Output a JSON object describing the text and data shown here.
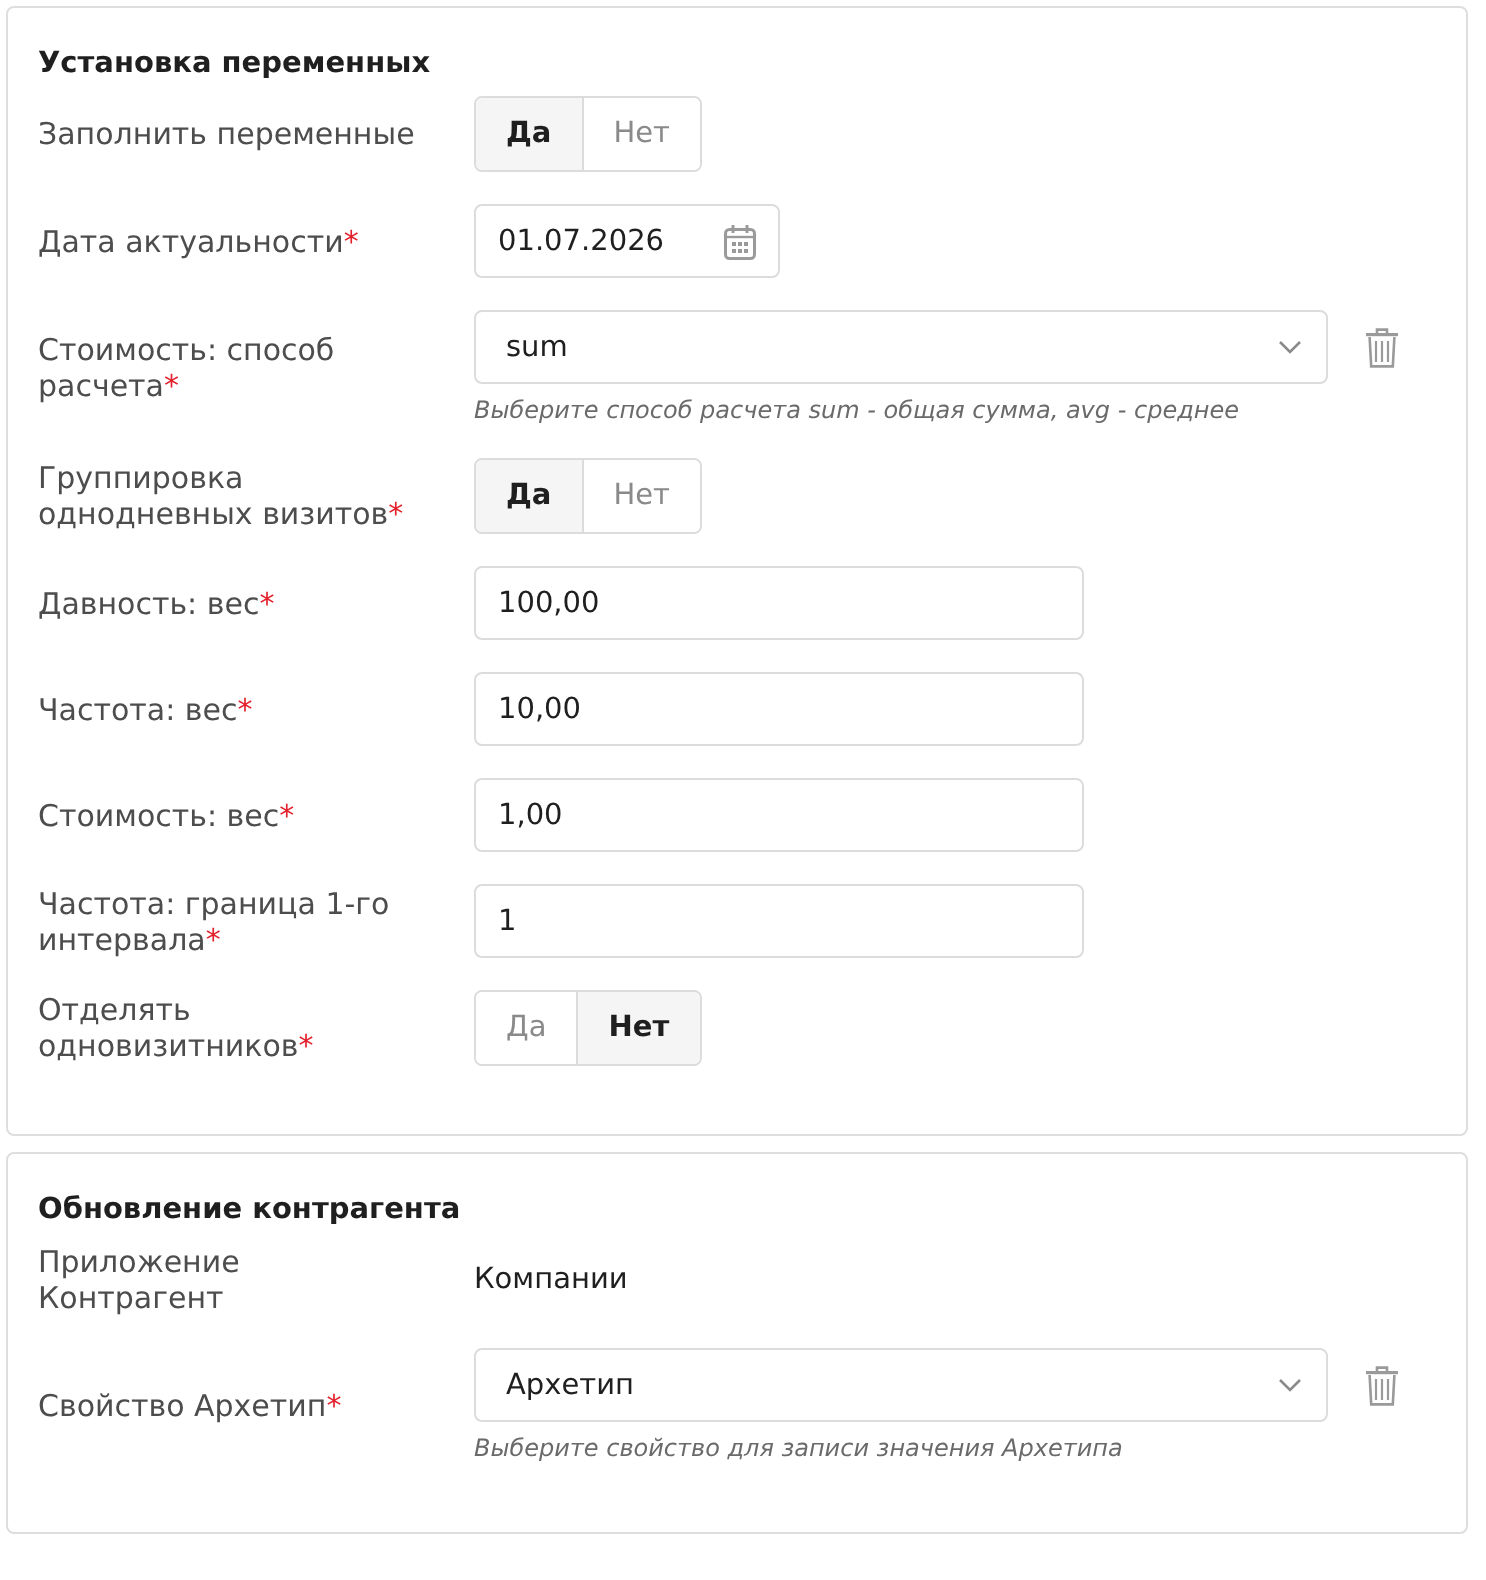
{
  "sections": [
    {
      "title": "Установка переменных",
      "fields": [
        {
          "kind": "toggle",
          "label": "Заполнить переменные",
          "options": [
            {
              "label": "Да",
              "selected": true
            },
            {
              "label": "Нет",
              "selected": false
            }
          ]
        },
        {
          "kind": "date",
          "label": "Дата актуальности",
          "required_mark": "*",
          "value": "01.07.2026"
        },
        {
          "kind": "select",
          "label": "Стоимость: способ расчета",
          "required_mark": "*",
          "value": "sum",
          "hint": "Выберите способ расчета sum - общая сумма, avg - среднее",
          "removable": true
        },
        {
          "kind": "toggle",
          "label": "Группировка однодневных визитов",
          "required_mark": "*",
          "options": [
            {
              "label": "Да",
              "selected": true
            },
            {
              "label": "Нет",
              "selected": false
            }
          ]
        },
        {
          "kind": "number",
          "label": "Давность: вес",
          "required_mark": "*",
          "value": "100,00"
        },
        {
          "kind": "number",
          "label": "Частота: вес",
          "required_mark": "*",
          "value": "10,00"
        },
        {
          "kind": "number",
          "label": "Стоимость: вес",
          "required_mark": "*",
          "value": "1,00"
        },
        {
          "kind": "number",
          "label": "Частота: граница 1-го интервала",
          "required_mark": "*",
          "value": "1"
        },
        {
          "kind": "toggle",
          "label": "Отделять одновизитников",
          "required_mark": "*",
          "options": [
            {
              "label": "Да",
              "selected": false
            },
            {
              "label": "Нет",
              "selected": true
            }
          ]
        }
      ]
    },
    {
      "title": "Обновление контрагента",
      "fields": [
        {
          "kind": "static",
          "label": "Приложение Контрагент",
          "value": "Компании"
        },
        {
          "kind": "select",
          "label": "Свойство Архетип",
          "required_mark": "*",
          "value": "Архетип",
          "hint": "Выберите свойство для записи значения Архетипа",
          "removable": true
        }
      ]
    }
  ]
}
